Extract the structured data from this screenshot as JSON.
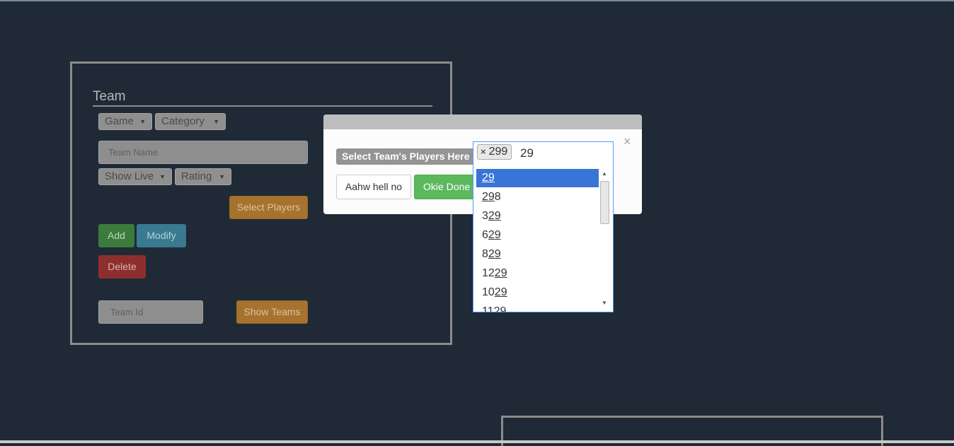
{
  "team": {
    "title": "Team",
    "game_label": "Game",
    "category_label": "Category",
    "team_name_placeholder": "Team Name",
    "show_live_label": "Show Live",
    "rating_label": "Rating",
    "select_players_label": "Select Players",
    "add_label": "Add",
    "modify_label": "Modify",
    "delete_label": "Delete",
    "team_id_placeholder": "Team Id",
    "show_teams_label": "Show Teams"
  },
  "modal": {
    "label": "Select Team's Players Here",
    "close": "×",
    "cancel_label": "Aahw hell no",
    "confirm_label": "Okie Done"
  },
  "select": {
    "selected_chip": "299",
    "chip_remove": "×",
    "search_value": "29",
    "options": [
      {
        "pre": "",
        "match": "29",
        "post": ""
      },
      {
        "pre": "",
        "match": "29",
        "post": "8"
      },
      {
        "pre": "3",
        "match": "29",
        "post": ""
      },
      {
        "pre": "6",
        "match": "29",
        "post": ""
      },
      {
        "pre": "8",
        "match": "29",
        "post": ""
      },
      {
        "pre": "12",
        "match": "29",
        "post": ""
      },
      {
        "pre": "10",
        "match": "29",
        "post": ""
      },
      {
        "pre": "11",
        "match": "29",
        "post": ""
      }
    ]
  },
  "colors": {
    "background": "#1f2a36",
    "highlight": "#3875d7"
  }
}
